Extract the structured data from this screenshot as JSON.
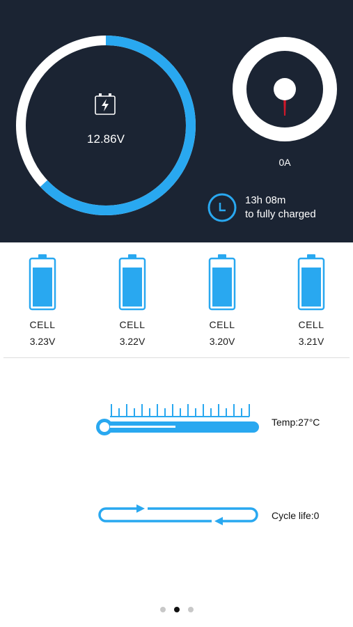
{
  "colors": {
    "accent": "#29a8f0",
    "dark_bg": "#1b2433",
    "needle": "#d0182a"
  },
  "battery_gauge": {
    "voltage": "12.86V",
    "fill_fraction": 0.63,
    "icon": "battery-charging-icon"
  },
  "current_gauge": {
    "current": "0A"
  },
  "charge_status": {
    "time": "13h 08m",
    "label": "to fully charged",
    "icon": "clock-icon"
  },
  "cells": [
    {
      "label": "CELL",
      "voltage": "3.23V"
    },
    {
      "label": "CELL",
      "voltage": "3.22V"
    },
    {
      "label": "CELL",
      "voltage": "3.20V"
    },
    {
      "label": "CELL",
      "voltage": "3.21V"
    }
  ],
  "temperature": {
    "label": "Temp:27°C",
    "icon": "thermometer-icon"
  },
  "cycle": {
    "label": "Cycle life:0",
    "icon": "cycle-icon"
  },
  "pagination": {
    "count": 3,
    "active_index": 1
  }
}
